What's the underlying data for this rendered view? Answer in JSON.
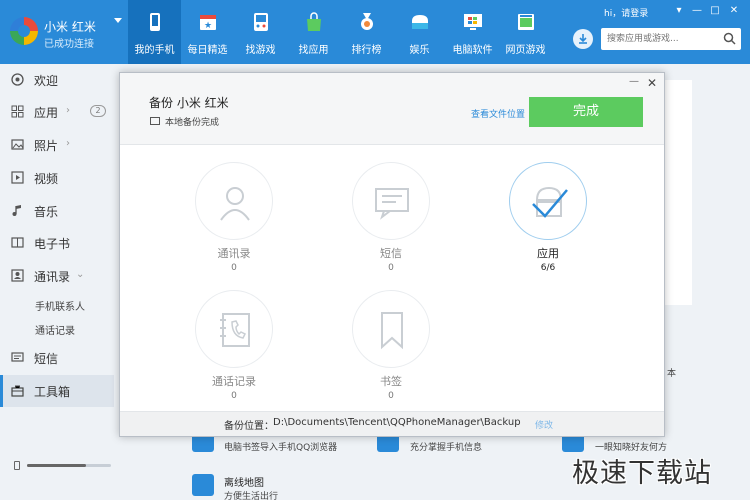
{
  "brand": {
    "device_name": "小米 红米",
    "status": "已成功连接"
  },
  "nav": [
    {
      "label": "我的手机",
      "icon": "phone-icon",
      "active": true
    },
    {
      "label": "每日精选",
      "icon": "calendar-star-icon"
    },
    {
      "label": "找游戏",
      "icon": "gamepad-icon"
    },
    {
      "label": "找应用",
      "icon": "shopping-bag-icon"
    },
    {
      "label": "排行榜",
      "icon": "medal-icon"
    },
    {
      "label": "娱乐",
      "icon": "cloud-icon"
    },
    {
      "label": "电脑软件",
      "icon": "monitor-icon"
    },
    {
      "label": "网页游戏",
      "icon": "web-game-icon"
    }
  ],
  "header": {
    "login": "hi，请登录",
    "search_placeholder": "搜索应用或游戏...",
    "window_controls": [
      "▾",
      "—",
      "□",
      "✕"
    ]
  },
  "sidebar": {
    "items": [
      {
        "label": "欢迎",
        "icon": "welcome-icon"
      },
      {
        "label": "应用",
        "icon": "apps-grid-icon",
        "badge": "2"
      },
      {
        "label": "照片",
        "icon": "photo-icon"
      },
      {
        "label": "视频",
        "icon": "video-icon"
      },
      {
        "label": "音乐",
        "icon": "music-icon"
      },
      {
        "label": "电子书",
        "icon": "book-icon"
      },
      {
        "label": "通讯录",
        "icon": "contacts-icon"
      },
      {
        "label": "短信",
        "icon": "sms-icon"
      },
      {
        "label": "工具箱",
        "icon": "toolbox-icon",
        "active": true
      }
    ],
    "sub_items": [
      "手机联系人",
      "通话记录"
    ],
    "volume_level": 0.7
  },
  "background": {
    "items": [
      "电脑书签导入手机QQ浏览器",
      "充分掌握手机信息",
      "一眼知晓好友何方",
      "离线地图",
      "方便生活出行"
    ],
    "side_text": "本"
  },
  "dialog": {
    "title": "备份 小米 红米",
    "subtitle": "本地备份完成",
    "view_location": "查看文件位置",
    "finish_label": "完成",
    "minimize": "—",
    "close": "✕",
    "tiles": [
      {
        "name": "通讯录",
        "count": "0",
        "icon": "contact-person-icon"
      },
      {
        "name": "短信",
        "count": "0",
        "icon": "message-icon"
      },
      {
        "name": "应用",
        "count": "6/6",
        "icon": "android-check-icon",
        "done": true
      },
      {
        "name": "通话记录",
        "count": "0",
        "icon": "call-log-icon"
      },
      {
        "name": "书签",
        "count": "0",
        "icon": "bookmark-icon"
      }
    ],
    "footer_label": "备份位置：",
    "footer_path": "D:\\Documents\\Tencent\\QQPhoneManager\\Backup",
    "footer_edit": "修改"
  },
  "watermark": "极速下载站",
  "colors": {
    "accent": "#2a8ad8",
    "active_nav": "#1671bd",
    "finish": "#5ccb5f"
  }
}
